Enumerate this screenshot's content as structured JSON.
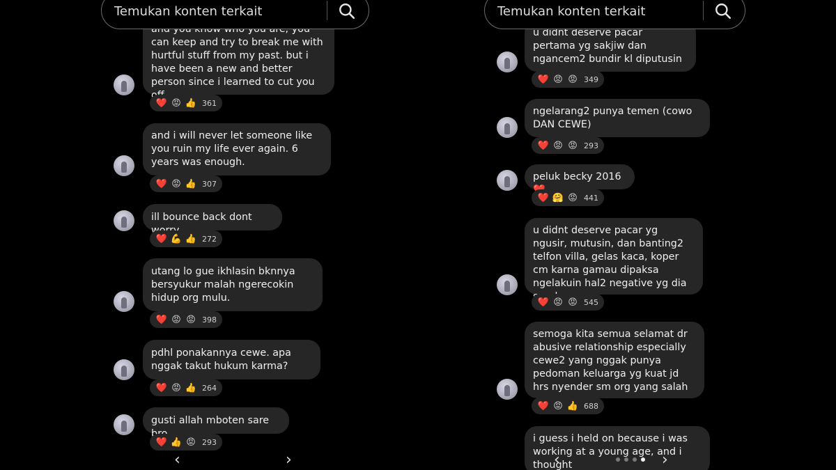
{
  "left": {
    "search_placeholder": "Temukan konten terkait",
    "comments": [
      {
        "text": "and you know who you are, you can keep and try to break me with hurtful stuff from my past. but i have been a new and better person since i learned to cut you off.",
        "reactions": [
          "❤️",
          "😡",
          "👍"
        ],
        "count": "361"
      },
      {
        "text": "and i will never let someone like you ruin my life ever again. 6 years was enough.",
        "reactions": [
          "❤️",
          "😡",
          "👍"
        ],
        "count": "307"
      },
      {
        "text": "ill bounce back dont worry",
        "reactions": [
          "❤️",
          "💪",
          "👍"
        ],
        "count": "272"
      },
      {
        "text": "utang lo gue ikhlasin bknnya bersyukur malah ngerecokin hidup org mulu.",
        "reactions": [
          "❤️",
          "😡",
          "😡"
        ],
        "count": "398"
      },
      {
        "text": "pdhl ponakannya cewe. apa nggak takut hukum karma?",
        "reactions": [
          "❤️",
          "😡",
          "👍"
        ],
        "count": "264"
      },
      {
        "text": "gusti allah mboten sare bro",
        "reactions": [
          "❤️",
          "👍",
          "😡"
        ],
        "count": "293"
      }
    ]
  },
  "right": {
    "search_placeholder": "Temukan konten terkait",
    "comments": [
      {
        "text": "u didnt deserve pacar pertama yg sakjiw dan ngancem2 bundir kl diputusin",
        "reactions": [
          "❤️",
          "😡",
          "😡"
        ],
        "count": "349"
      },
      {
        "text": "ngelarang2 punya temen (cowo DAN CEWE)",
        "reactions": [
          "❤️",
          "😡",
          "😡"
        ],
        "count": "293"
      },
      {
        "text": "peluk becky 2016❤️",
        "reactions": [
          "❤️",
          "🤗",
          "😡"
        ],
        "count": "441"
      },
      {
        "text": "u didnt deserve pacar yg ngusir, mutusin, dan banting2 telfon villa, gelas kaca, koper cm karna gamau dipaksa ngelakuin hal2 negative yg dia suruh",
        "reactions": [
          "❤️",
          "😡",
          "😡"
        ],
        "count": "545"
      },
      {
        "text": "semoga kita semua selamat dr abusive relationship especially cewe2 yang nggak punya pedoman keluarga yg kuat jd hrs nyender sm org yang salah",
        "reactions": [
          "❤️",
          "😡",
          "👍"
        ],
        "count": "688"
      },
      {
        "text": "i guess i held on because i was working at a young age, and i thought",
        "reactions": [],
        "count": ""
      }
    ]
  },
  "icons": {
    "search": "search-icon",
    "prev": "chevron-left-icon",
    "next": "chevron-right-icon"
  }
}
